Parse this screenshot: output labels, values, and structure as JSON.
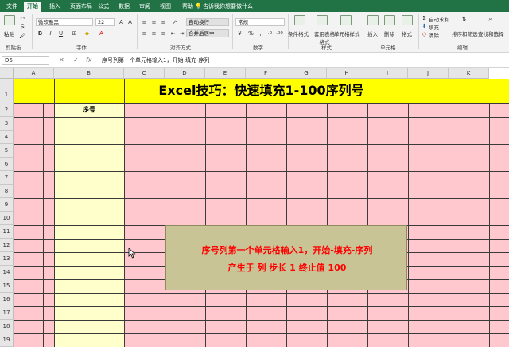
{
  "tabs": [
    "文件",
    "开始",
    "插入",
    "页面布局",
    "公式",
    "数据",
    "审阅",
    "视图",
    "帮助"
  ],
  "active_tab": "开始",
  "tell_me": "告诉我你想要做什么",
  "ribbon": {
    "paste_label": "粘贴",
    "clipboard_label": "剪贴板",
    "font_name": "微软雅黑",
    "font_size": "22",
    "font_group_label": "字体",
    "wrap_text": "自动换行",
    "merge_center": "合并后居中",
    "alignment_label": "对齐方式",
    "number_format": "常规",
    "number_label": "数字",
    "conditional_format": "条件格式",
    "format_as_table": "套用表格格式",
    "cell_styles": "单元格样式",
    "styles_label": "样式",
    "insert": "插入",
    "delete": "删除",
    "format": "格式",
    "cells_label": "单元格",
    "autosum": "自动求和",
    "fill": "填充",
    "clear": "清除",
    "sort_filter": "排序和筛选",
    "find_select": "查找和选择",
    "editing_label": "编辑",
    "bold": "B",
    "italic": "I",
    "underline": "U",
    "percent": "%",
    "comma": ","
  },
  "formula_bar": {
    "name_box": "D6",
    "cancel": "✕",
    "enter": "✓",
    "fx": "fx",
    "formula": "序号列第一个单元格输入1，开始-填充-序列"
  },
  "columns": [
    "A",
    "B",
    "C",
    "D",
    "E",
    "F",
    "G",
    "H",
    "I",
    "J",
    "K"
  ],
  "rows": [
    "1",
    "2",
    "3",
    "4",
    "5",
    "6",
    "7",
    "8",
    "9",
    "10",
    "11",
    "12",
    "13",
    "14",
    "15",
    "16",
    "17",
    "18",
    "19"
  ],
  "sheet": {
    "title": "Excel技巧：快速填充1-100序列号",
    "header": "序号"
  },
  "note": {
    "line1": "序号列第一个单元格输入1，开始-填充-序列",
    "line2": "产生于 列   步长 1     终止值 100"
  },
  "colors": {
    "accent": "#217346",
    "title_fill": "#ffff00",
    "grid_fill": "#ffc7ce",
    "column_b_fill": "#ffffcc",
    "note_fill": "#c8c496",
    "note_text": "#ff0000"
  }
}
